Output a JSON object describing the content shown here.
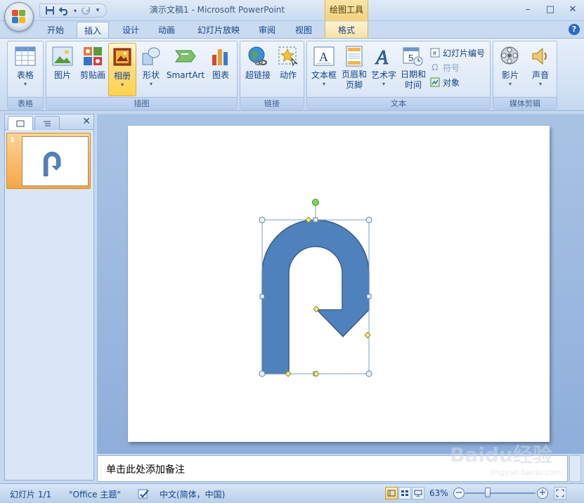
{
  "window": {
    "title": "演示文稿1 - Microsoft PowerPoint",
    "context_tools": "绘图工具",
    "minimize": "–",
    "maximize": "□",
    "close": "✕"
  },
  "quick_access": {
    "save": "save-icon",
    "undo": "undo-icon",
    "redo": "redo-icon",
    "customize": "▾"
  },
  "tabs": [
    {
      "label": "开始"
    },
    {
      "label": "插入",
      "active": true
    },
    {
      "label": "设计"
    },
    {
      "label": "动画"
    },
    {
      "label": "幻灯片放映"
    },
    {
      "label": "审阅"
    },
    {
      "label": "视图"
    },
    {
      "label": "格式",
      "context": true
    }
  ],
  "help": "?",
  "ribbon": {
    "groups": {
      "table": "表格",
      "illustrations": "插图",
      "links": "链接",
      "text": "文本",
      "media": "媒体剪辑"
    },
    "buttons": {
      "table": "表格",
      "picture": "图片",
      "clipart": "剪贴画",
      "album": "相册",
      "shapes": "形状",
      "smartart": "SmartArt",
      "chart": "图表",
      "hyperlink": "超链接",
      "action": "动作",
      "textbox": "文本框",
      "header_footer_1": "页眉和",
      "header_footer_2": "页脚",
      "wordart": "艺术字",
      "datetime_1": "日期和",
      "datetime_2": "时间",
      "slide_number": "幻灯片编号",
      "symbol": "符号",
      "object": "对象",
      "movie": "影片",
      "sound": "声音"
    }
  },
  "left_pane": {
    "slide_number": "1",
    "close": "✕"
  },
  "notes": {
    "placeholder": "单击此处添加备注"
  },
  "watermark": {
    "text": "Baidu经验",
    "sub": "jingyan.baidu.com"
  },
  "status": {
    "slide": "幻灯片 1/1",
    "theme": "\"Office 主题\"",
    "language": "中文(简体，中国)",
    "zoom": "63%",
    "zoom_fraction": 0.32
  },
  "colors": {
    "shape_fill": "#4f81bd",
    "shape_stroke": "#385d8a",
    "handle_yellow": "#f3f27b",
    "handle_green": "#7ed957"
  }
}
